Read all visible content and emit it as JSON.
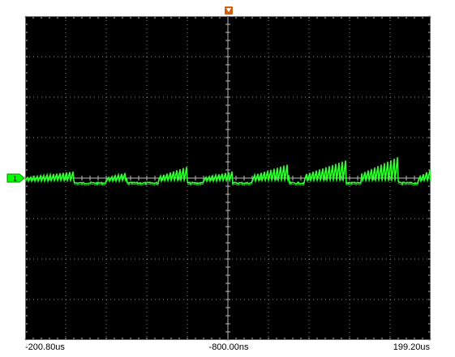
{
  "colors": {
    "screen_background": "#000000",
    "grid_major": "#8c8c8c",
    "grid_minor": "#6a6a6a",
    "trace": "#33ff33",
    "channel_marker": "#00ff00",
    "trigger_marker": "#d06010",
    "outer_background": "#ffffff"
  },
  "icons": {
    "channel_marker": "channel-1-ground-marker-icon",
    "trigger_marker": "trigger-position-marker-icon"
  },
  "channel": {
    "label": "1"
  },
  "time_axis": {
    "left_label": "-200.80us",
    "center_label": "-800.00ns",
    "right_label": "199.20us"
  },
  "grid": {
    "horizontal_divisions": 10,
    "vertical_divisions": 8,
    "minor_per_division": 5
  },
  "waveform": {
    "description_of_signal": "",
    "bursts": [
      {
        "start": 0.0,
        "end": 0.12,
        "peak": 0.25
      },
      {
        "start": 0.2,
        "end": 0.25,
        "peak": 0.22
      },
      {
        "start": 0.33,
        "end": 0.4,
        "peak": 0.38
      },
      {
        "start": 0.44,
        "end": 0.51,
        "peak": 0.25
      },
      {
        "start": 0.56,
        "end": 0.65,
        "peak": 0.45
      },
      {
        "start": 0.69,
        "end": 0.79,
        "peak": 0.55
      },
      {
        "start": 0.83,
        "end": 0.92,
        "peak": 0.65
      },
      {
        "start": 0.97,
        "end": 1.0,
        "peak": 0.3
      }
    ]
  }
}
